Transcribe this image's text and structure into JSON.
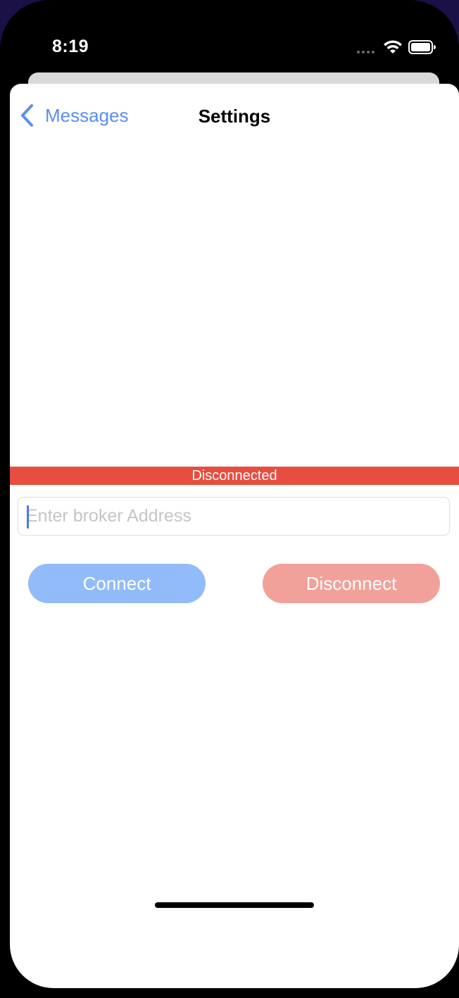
{
  "status_bar": {
    "time": "8:19"
  },
  "nav": {
    "back_label": "Messages",
    "title": "Settings"
  },
  "connection": {
    "status": "Disconnected",
    "status_color": "#e84d3f"
  },
  "broker_input": {
    "placeholder": "Enter broker Address",
    "value": ""
  },
  "buttons": {
    "connect_label": "Connect",
    "connect_color": "#92bbf9",
    "disconnect_label": "Disconnect",
    "disconnect_color": "#f2a19a"
  },
  "colors": {
    "accent": "#5b8ef2"
  }
}
